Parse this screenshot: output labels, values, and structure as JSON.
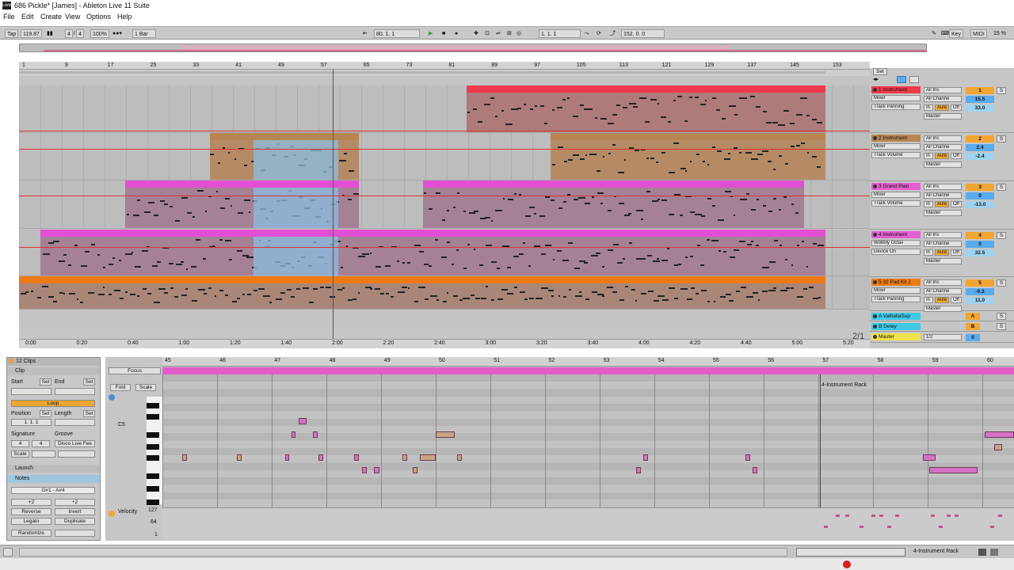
{
  "window": {
    "title": "686 Pickle* [James] - Ableton Live 11 Suite",
    "icon_label": "Live"
  },
  "menu": [
    "File",
    "Edit",
    "Create",
    "View",
    "Options",
    "Help"
  ],
  "control_bar": {
    "tap": "Tap",
    "tempo": "119.87",
    "time_sig_num": "4",
    "time_sig_den": "4",
    "zoom": "100%",
    "quantize": "1 Bar",
    "arrangement_position": "80.  1.  1",
    "loop_start": "1.  1.  1",
    "loop_length": "152.  0.  0",
    "key_label": "Key",
    "midi_label": "MIDI",
    "cpu": "15 %"
  },
  "arrangement": {
    "bar_ticks": [
      "1",
      "9",
      "17",
      "25",
      "33",
      "41",
      "49",
      "57",
      "65",
      "73",
      "81",
      "89",
      "97",
      "105",
      "113",
      "121",
      "129",
      "137",
      "145",
      "153"
    ],
    "time_ticks": [
      "0:00",
      "0:20",
      "0:40",
      "1:00",
      "1:20",
      "1:40",
      "2:00",
      "2:20",
      "2:40",
      "3:00",
      "3:20",
      "3:40",
      "4:00",
      "4:20",
      "4:40",
      "5:00",
      "5:20"
    ],
    "zoom_readout": "2/1",
    "tracks": [
      {
        "name": "1 Instrument",
        "number": "1",
        "color": "#ef3a4c",
        "input": "All Ins",
        "channel": "All Channe",
        "device": "Mixer",
        "param": "Track Panning",
        "value": "15.5",
        "value2": "33.0",
        "output": "Master",
        "monitor_in": "In",
        "monitor_auto": "Auto",
        "monitor_off": "Off"
      },
      {
        "name": "2 Instrument",
        "number": "2",
        "color": "#b78552",
        "input": "All Ins",
        "channel": "All Channe",
        "device": "Mixer",
        "param": "Track Volume",
        "value": "2.4",
        "value2": "-2.4",
        "output": "Master",
        "monitor_in": "In",
        "monitor_auto": "Auto",
        "monitor_off": "Off"
      },
      {
        "name": "3 Grand Pian",
        "number": "3",
        "color": "#e35fd0",
        "input": "All Ins",
        "channel": "All Channe",
        "device": "Mixer",
        "param": "Track Volume",
        "value": "0",
        "value2": "-13.0",
        "output": "Master",
        "monitor_in": "In",
        "monitor_auto": "Auto",
        "monitor_off": "Off"
      },
      {
        "name": "4 Instrument",
        "number": "4",
        "color": "#e35fd0",
        "input": "All Ins",
        "channel": "All Channe",
        "device": "Wobbly Octav",
        "param": "Device On",
        "value": "0",
        "value2": "32.5",
        "output": "Master",
        "monitor_in": "In",
        "monitor_auto": "Auto",
        "monitor_off": "Off"
      },
      {
        "name": "5 32 Pad Kit J",
        "number": "5",
        "color": "#ee7a16",
        "input": "All Ins",
        "channel": "All Channe",
        "device": "Mixer",
        "param": "Track Panning",
        "value": "-9.3",
        "value2": "11.0",
        "output": "Master",
        "monitor_in": "In",
        "monitor_auto": "Auto",
        "monitor_off": "Off"
      }
    ],
    "returns": [
      {
        "name": "A ValhallaSup",
        "letter": "A"
      },
      {
        "name": "B Delay",
        "letter": "B"
      }
    ],
    "master": {
      "name": "Master",
      "value": "1/2",
      "number": "0"
    },
    "set_label": "Set",
    "solo_label": "S"
  },
  "clip_view": {
    "header": "12 Clips",
    "clip_section": "Clip",
    "start_label": "Start",
    "end_label": "End",
    "set_label": "Set",
    "loop_label": "Loop",
    "position_label": "Position",
    "length_label": "Length",
    "position_value": "1.  1.  1",
    "signature_label": "Signature",
    "groove_label": "Groove",
    "sig_num": "4",
    "sig_den": "4",
    "groove_value": "Disco Live Fee",
    "scale_label": "Scale",
    "launch_label": "Launch",
    "notes_label": "Notes",
    "note_range": "G#1 - A#4",
    "btn_x2": "+2",
    "btn_d2": "÷2",
    "reverse": "Reverse",
    "invert": "Invert",
    "legato": "Legato",
    "duplicate": "Duplicate",
    "randomize": "Randomize",
    "focus": "Focus",
    "fold": "Fold",
    "scale_btn": "Scale",
    "c5": "C5"
  },
  "midi_editor": {
    "bar_ticks": [
      "45",
      "46",
      "47",
      "48",
      "49",
      "50",
      "51",
      "52",
      "53",
      "54",
      "55",
      "56",
      "57",
      "58",
      "59",
      "60"
    ],
    "rack_label": "4-Instrument Rack",
    "velocity_label": "Velocity",
    "vel_127": "127",
    "vel_64": "64",
    "vel_1": "1"
  },
  "status": {
    "right_label": "4-Instrument Rack"
  }
}
